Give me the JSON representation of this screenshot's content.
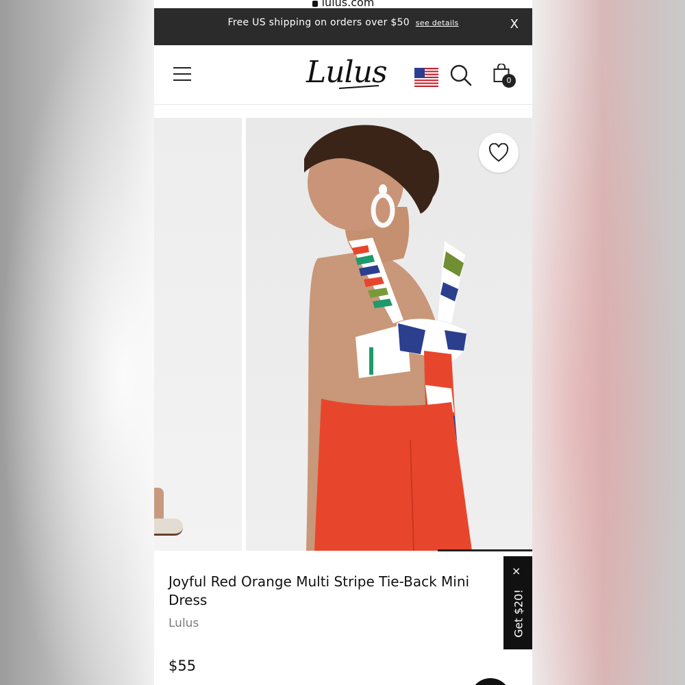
{
  "browser": {
    "url": "lulus.com"
  },
  "promo_bar": {
    "text": "Free US shipping on orders over $50",
    "link": "see details",
    "close": "X"
  },
  "header": {
    "logo": "Lulus",
    "cart_count": "0",
    "icons": [
      "menu-icon",
      "us-flag-icon",
      "search-icon",
      "shopping-bag-icon"
    ]
  },
  "product": {
    "title": "Joyful Red Orange Multi Stripe Tie-Back Mini Dress",
    "brand": "Lulus",
    "price": "$55"
  },
  "promo_tab": {
    "label": "Get $20!",
    "close": "×"
  },
  "colors": {
    "promo_bar_bg": "#2b2b2b",
    "dress_red": "#e8462c",
    "text_primary": "#111111",
    "text_muted": "#7a7a7a"
  }
}
